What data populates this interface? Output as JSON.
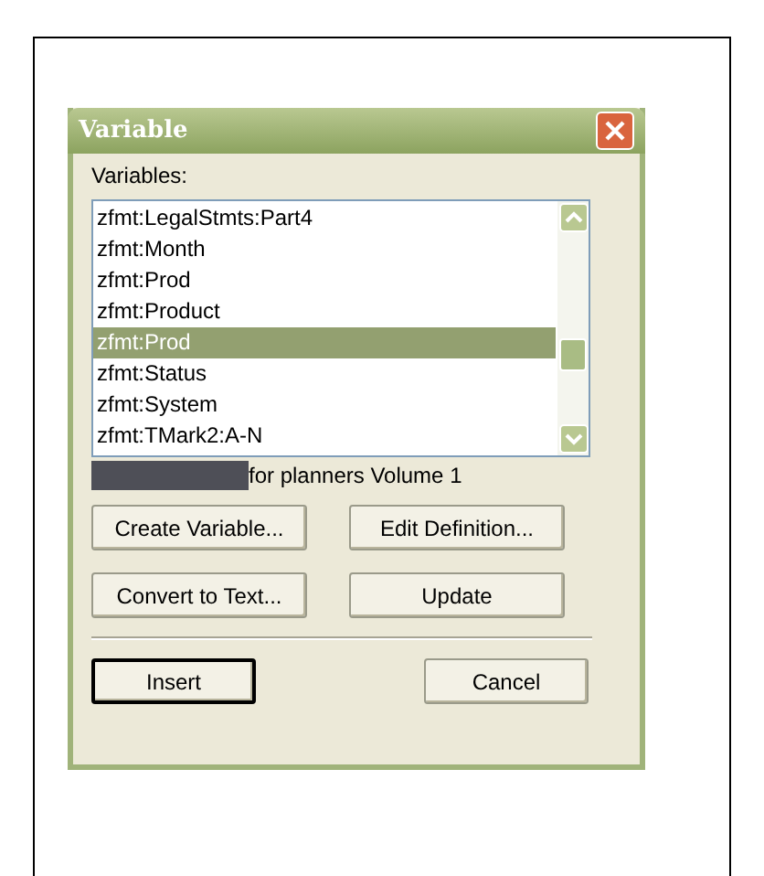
{
  "window": {
    "title": "Variable"
  },
  "list": {
    "label": "Variables:",
    "items": [
      {
        "text": "zfmt:LegalStmts:Part4",
        "selected": false
      },
      {
        "text": "zfmt:Month",
        "selected": false
      },
      {
        "text": "zfmt:Prod",
        "selected": false
      },
      {
        "text": "zfmt:Product",
        "selected": false
      },
      {
        "text": "zfmt:Prod",
        "selected": true
      },
      {
        "text": "zfmt:Status",
        "selected": false
      },
      {
        "text": "zfmt:System",
        "selected": false
      },
      {
        "text": "zfmt:TMark2:A-N",
        "selected": false
      }
    ]
  },
  "preview": {
    "text": "for planners Volume 1"
  },
  "buttons": [
    {
      "label": "Create Variable...",
      "default": false
    },
    {
      "label": "Edit Definition...",
      "default": false
    },
    {
      "label": "Convert to Text...",
      "default": false
    },
    {
      "label": "Update",
      "default": false
    }
  ],
  "footer_buttons": [
    {
      "label": "Insert",
      "default": true
    },
    {
      "label": "Cancel",
      "default": false
    }
  ]
}
